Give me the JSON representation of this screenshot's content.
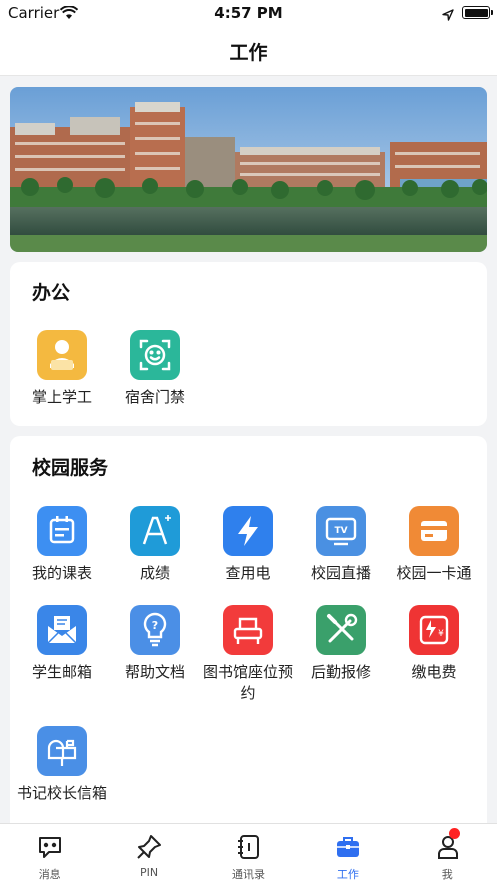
{
  "status_bar": {
    "carrier": "Carrier",
    "time": "4:57 PM"
  },
  "nav": {
    "title": "工作"
  },
  "office": {
    "title": "办公",
    "items": [
      {
        "label": "掌上学工",
        "icon": "student-work-icon",
        "color": "#f4b940"
      },
      {
        "label": "宿舍门禁",
        "icon": "face-scan-icon",
        "color": "#2bb79a"
      }
    ]
  },
  "campus": {
    "title": "校园服务",
    "items": [
      {
        "label": "我的课表",
        "icon": "schedule-icon",
        "color": "#3d8ff2"
      },
      {
        "label": "成绩",
        "icon": "grade-icon",
        "color": "#1f9bd8"
      },
      {
        "label": "查用电",
        "icon": "electricity-icon",
        "color": "#2f80ed"
      },
      {
        "label": "校园直播",
        "icon": "tv-icon",
        "color": "#4a90e2"
      },
      {
        "label": "校园一卡通",
        "icon": "card-icon",
        "color": "#f08a36"
      },
      {
        "label": "学生邮箱",
        "icon": "mail-icon",
        "color": "#3a86e8"
      },
      {
        "label": "帮助文档",
        "icon": "help-bulb-icon",
        "color": "#4b8fe6"
      },
      {
        "label": "图书馆座位预约",
        "icon": "library-seat-icon",
        "color": "#f23b3b"
      },
      {
        "label": "后勤报修",
        "icon": "repair-tools-icon",
        "color": "#3aa06b"
      },
      {
        "label": "缴电费",
        "icon": "pay-electricity-icon",
        "color": "#ef3434"
      },
      {
        "label": "书记校长信箱",
        "icon": "mailbox-icon",
        "color": "#4a8fe6"
      }
    ]
  },
  "tabs": [
    {
      "label": "消息",
      "icon": "message-icon",
      "active": false
    },
    {
      "label": "PIN",
      "icon": "pin-icon",
      "active": false
    },
    {
      "label": "通讯录",
      "icon": "contacts-icon",
      "active": false
    },
    {
      "label": "工作",
      "icon": "briefcase-icon",
      "active": true
    },
    {
      "label": "我",
      "icon": "profile-icon",
      "active": false
    }
  ]
}
